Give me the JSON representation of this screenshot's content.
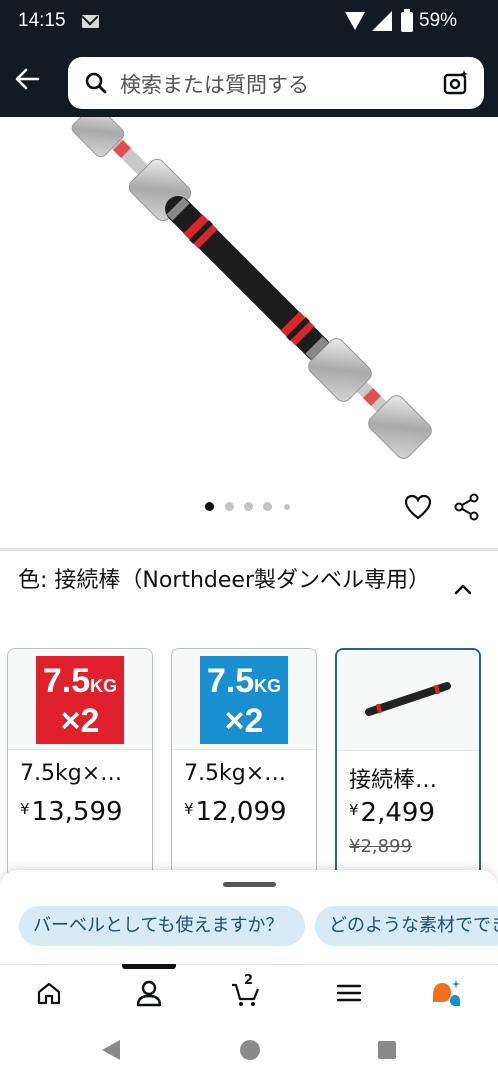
{
  "status": {
    "time": "14:15",
    "battery": "59%"
  },
  "header": {
    "search_placeholder": "検索または質問する",
    "icons": [
      "back-arrow-icon",
      "search-icon",
      "camera-search-icon"
    ]
  },
  "product_image": {
    "carousel_total": 5,
    "carousel_active": 1,
    "actions": [
      "heart-icon",
      "share-icon"
    ]
  },
  "color_section": {
    "label": "色:  接続棒（Northdeer製ダンベル専用）"
  },
  "variants": [
    {
      "badge_line1": "7.5",
      "badge_unit": "KG",
      "badge_line2": "×2",
      "badge_color": "#e0202c",
      "name": "7.5kg×…",
      "yen": "¥",
      "price": "13,599"
    },
    {
      "badge_line1": "7.5",
      "badge_unit": "KG",
      "badge_line2": "×2",
      "badge_color": "#1a8fd0",
      "name": "7.5kg×…",
      "yen": "¥",
      "price": "12,099"
    },
    {
      "name": "接続棒…",
      "yen": "¥",
      "price": "2,499",
      "old_price": "¥2,899",
      "selected": true
    }
  ],
  "suggestions": [
    "バーベルとしても使えますか？",
    "どのような素材でできていますか"
  ],
  "bottom_nav": {
    "items": [
      "home-icon",
      "account-icon",
      "cart-icon",
      "menu-icon",
      "rufus-icon"
    ],
    "cart_count": "2",
    "accent_colors": {
      "rufus_orange": "#f3701e",
      "rufus_blue": "#1a8fd0"
    }
  }
}
